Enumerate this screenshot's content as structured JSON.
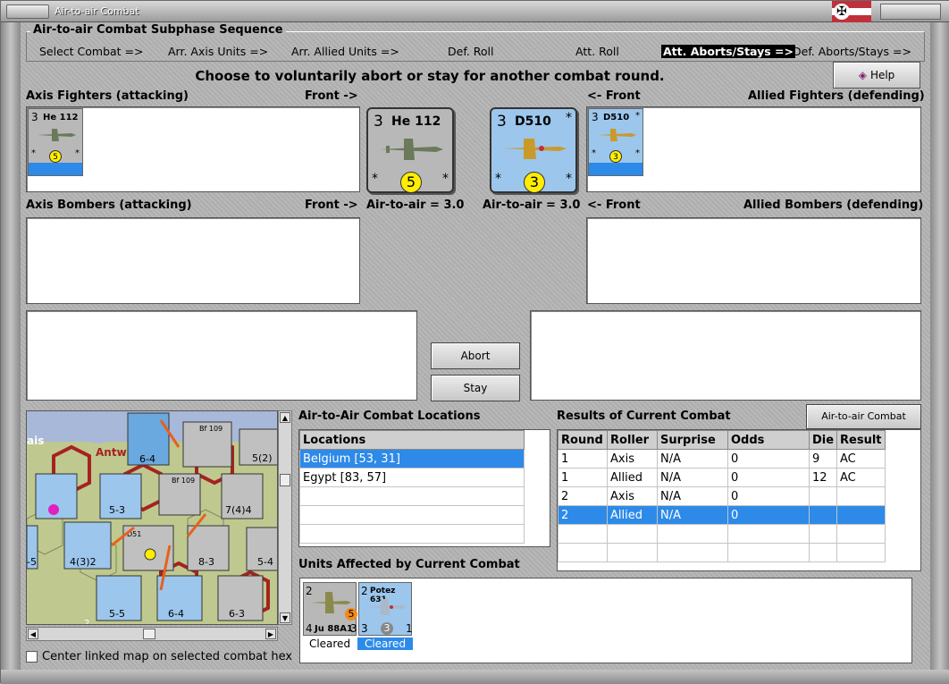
{
  "window": {
    "title": "Air-to-air Combat"
  },
  "subphase": {
    "title": "Air-to-air Combat Subphase Sequence",
    "steps": [
      {
        "label": "Select Combat =>"
      },
      {
        "label": "Arr. Axis Units =>"
      },
      {
        "label": "Arr. Allied Units =>"
      },
      {
        "label": "Def. Roll"
      },
      {
        "label": "Att. Roll"
      },
      {
        "label": "Att. Aborts/Stays =>"
      },
      {
        "label": "Def. Aborts/Stays =>"
      }
    ]
  },
  "heading": "Choose to voluntarily abort or stay for another combat round.",
  "help_label": "Help",
  "labels": {
    "axis_fighters": "Axis Fighters (attacking)",
    "front_right": "Front ->",
    "front_left": "<- Front",
    "allied_fighters": "Allied Fighters (defending)",
    "axis_bombers": "Axis Bombers (attacking)",
    "front_right_2": "Front ->",
    "air_to_air_axis": "Air-to-air = 3.0",
    "air_to_air_allied": "Air-to-air = 3.0",
    "front_left_2": "<- Front",
    "allied_bombers": "Allied Bombers (defending)",
    "combat_locations": "Air-to-Air Combat Locations",
    "results": "Results of Current Combat",
    "units_affected": "Units Affected by Current Combat"
  },
  "axis_fighter": {
    "strength": "3",
    "name": "He 112",
    "star": "*",
    "value": "5"
  },
  "allied_fighter": {
    "strength": "3",
    "name": "D510",
    "star": "*",
    "value": "3"
  },
  "buttons": {
    "abort": "Abort",
    "stay": "Stay",
    "chart": "Air-to-air Combat Chart"
  },
  "map": {
    "labels": [
      "ais",
      "Antw",
      "Bf 109",
      "Bf 109",
      "6-4",
      "5-3",
      "7(4)4",
      "5(2)",
      "4(3)2",
      "8-3",
      "5-4",
      "5-5",
      "6-4",
      "6-3",
      "-5",
      "2",
      "D51"
    ],
    "center_check_label": "Center linked map on selected combat hex"
  },
  "locations": {
    "header": "Locations",
    "rows": [
      "Belgium [53, 31]",
      "Egypt [83, 57]",
      "",
      "",
      "",
      ""
    ]
  },
  "results": {
    "headers": [
      "Round",
      "Roller",
      "Surprise",
      "Odds",
      "Die",
      "Result"
    ],
    "rows": [
      [
        "1",
        "Axis",
        "N/A",
        "0",
        "9",
        "AC"
      ],
      [
        "1",
        "Allied",
        "N/A",
        "0",
        "12",
        "AC"
      ],
      [
        "2",
        "Axis",
        "N/A",
        "0",
        "",
        ""
      ],
      [
        "2",
        "Allied",
        "N/A",
        "0",
        "",
        ""
      ],
      [
        "",
        "",
        "",
        "",
        "",
        ""
      ],
      [
        "",
        "",
        "",
        "",
        "",
        ""
      ]
    ]
  },
  "units_affected": [
    {
      "name": "Ju 88A1",
      "top_left": "2",
      "bottom_left": "4",
      "mid_right": "5",
      "bottom_right": "3",
      "caption": "Cleared"
    },
    {
      "name": "Potez 631",
      "top_left": "2",
      "bottom_left": "3",
      "mid_right": "3",
      "bottom_right": "1",
      "caption": "Cleared"
    }
  ],
  "colors": {
    "selection": "#2d8ae8",
    "axis_counter": "#b8b8b8",
    "allied_counter": "#9cc6ec",
    "hex_border": "#a52222"
  }
}
